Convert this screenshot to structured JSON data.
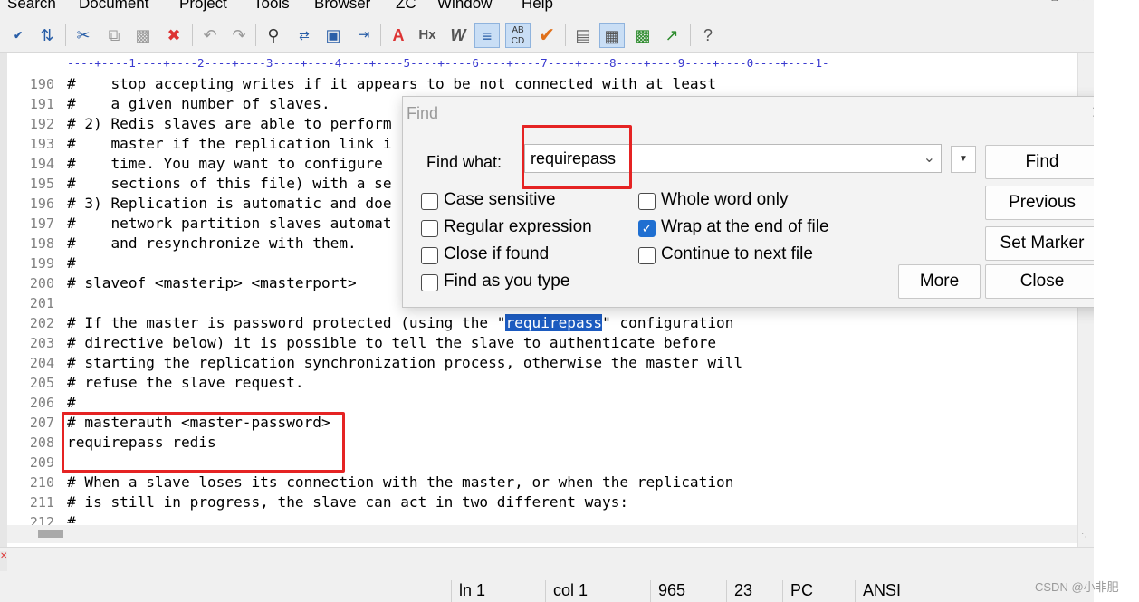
{
  "menu": [
    "Search",
    "Document",
    "Project",
    "Tools",
    "Browser",
    "ZC",
    "Window",
    "Help"
  ],
  "toolbar": {
    "icons": [
      "spellcheck-icon",
      "html-tidy-icon",
      "cut-icon",
      "copy-icon",
      "paste-icon",
      "delete-icon",
      "undo-icon",
      "redo-icon",
      "find-icon",
      "replace-icon",
      "find-in-files-icon",
      "goto-icon",
      "font-icon",
      "hex-icon",
      "word-wrap-icon",
      "indent-icon",
      "sort-icon",
      "check-icon",
      "column-icon",
      "grid-icon",
      "view-icon",
      "export-icon",
      "help-icon"
    ]
  },
  "editor": {
    "ruler": "----+----1----+----2----+----3----+----4----+----5----+----6----+----7----+----8----+----9----+----0----+----1-",
    "line_numbers": [
      "190",
      "191",
      "192",
      "193",
      "194",
      "195",
      "196",
      "197",
      "198",
      "199",
      "200",
      "201",
      "202",
      "203",
      "204",
      "205",
      "206",
      "207",
      "208",
      "209",
      "210",
      "211",
      "212"
    ],
    "lines": [
      "#    stop accepting writes if it appears to be not connected with at least",
      "#    a given number of slaves.",
      "# 2) Redis slaves are able to perform",
      "#    master if the replication link i",
      "#    time. You may want to configure",
      "#    sections of this file) with a se",
      "# 3) Replication is automatic and doe",
      "#    network partition slaves automat",
      "#    and resynchronize with them.",
      "#",
      "# slaveof <masterip> <masterport>",
      "",
      "",
      "# directive below) it is possible to tell the slave to authenticate before",
      "# starting the replication synchronization process, otherwise the master will",
      "# refuse the slave request.",
      "#",
      "# masterauth <master-password>",
      "requirepass redis",
      "",
      "# When a slave loses its connection with the master, or when the replication",
      "# is still in progress, the slave can act in two different ways:",
      "#"
    ],
    "line202_prefix": "# If the master is password protected (using the \"",
    "line202_match": "requirepass",
    "line202_suffix": "\" configuration"
  },
  "find_dialog": {
    "title": "Find",
    "find_what_label": "Find what:",
    "search_value": "requirepass",
    "options": [
      {
        "label": "Case sensitive",
        "checked": false
      },
      {
        "label": "Regular expression",
        "checked": false
      },
      {
        "label": "Close if found",
        "checked": false
      },
      {
        "label": "Find as you type",
        "checked": false
      },
      {
        "label": "Whole word only",
        "checked": false
      },
      {
        "label": "Wrap at the end of file",
        "checked": true
      },
      {
        "label": "Continue to next file",
        "checked": false
      }
    ],
    "buttons": {
      "find": "Find",
      "previous": "Previous",
      "set_marker": "Set Marker",
      "more": "More",
      "close": "Close"
    }
  },
  "status": {
    "line": "ln 1",
    "col": "col 1",
    "chars": "965",
    "lines": "23",
    "format": "PC",
    "encoding": "ANSI"
  },
  "watermark": "CSDN @小非肥"
}
